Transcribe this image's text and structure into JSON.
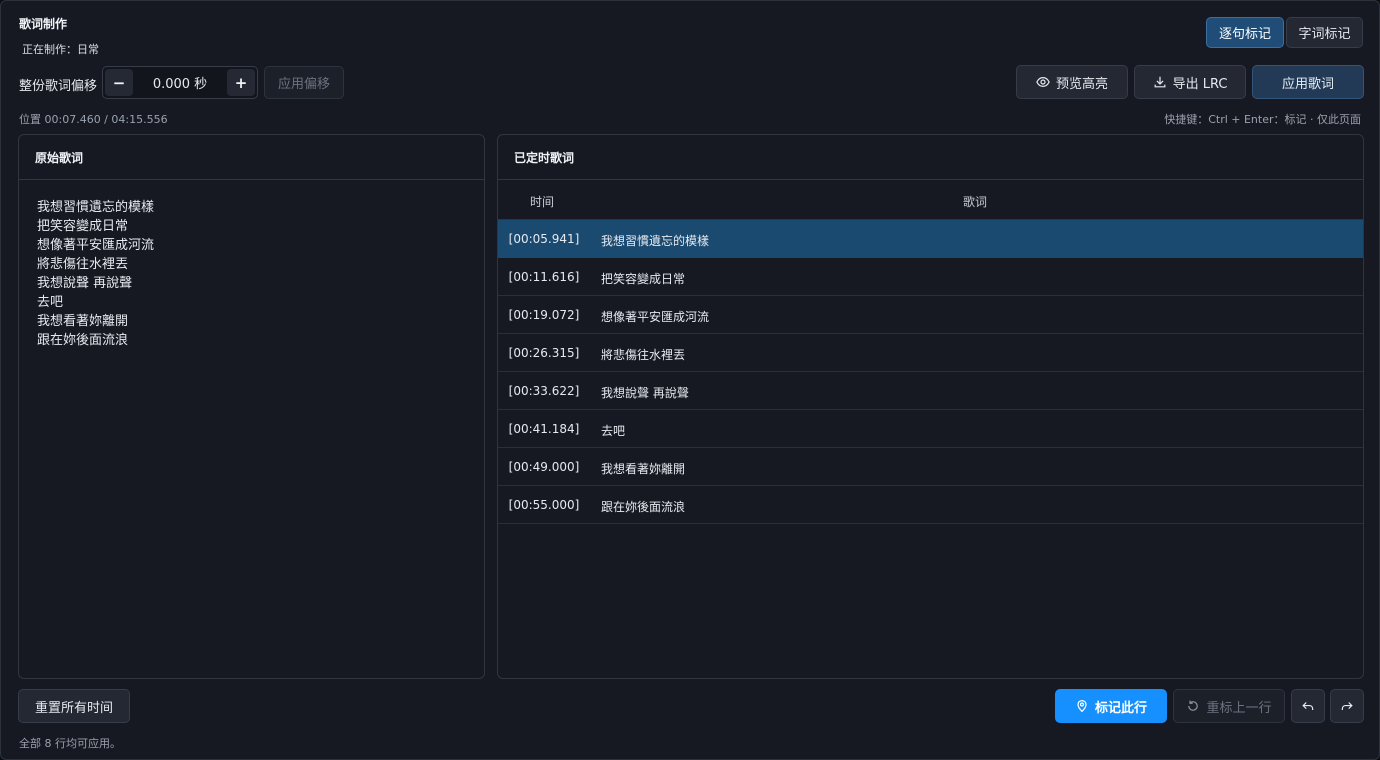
{
  "header": {
    "title": "歌词制作",
    "subtitle": "正在制作：日常",
    "mode_line": "逐句标记",
    "mode_word": "字词标记"
  },
  "offset": {
    "label": "整份歌词偏移",
    "minus": "−",
    "value": "0.000 秒",
    "plus": "+",
    "apply": "应用偏移"
  },
  "actions": {
    "preview": "预览高亮",
    "export": "导出 LRC",
    "apply_lyrics": "应用歌词"
  },
  "status": {
    "position": "位置 00:07.460 / 04:15.556",
    "shortcut": "快捷键：Ctrl + Enter：标记 · 仅此页面"
  },
  "raw_panel": {
    "title": "原始歌词",
    "lines": [
      "我想習慣遺忘的模樣",
      "把笑容變成日常",
      "想像著平安匯成河流",
      "將悲傷往水裡丟",
      "我想說聲 再說聲",
      "去吧",
      "我想看著妳離開",
      "跟在妳後面流浪"
    ]
  },
  "timed_panel": {
    "title": "已定时歌词",
    "col_time": "时间",
    "col_lyric": "歌词",
    "rows": [
      {
        "time": "[00:05.941]",
        "lyric": "我想習慣遺忘的模樣"
      },
      {
        "time": "[00:11.616]",
        "lyric": "把笑容變成日常"
      },
      {
        "time": "[00:19.072]",
        "lyric": "想像著平安匯成河流"
      },
      {
        "time": "[00:26.315]",
        "lyric": "將悲傷往水裡丟"
      },
      {
        "time": "[00:33.622]",
        "lyric": "我想說聲 再說聲"
      },
      {
        "time": "[00:41.184]",
        "lyric": "去吧"
      },
      {
        "time": "[00:49.000]",
        "lyric": "我想看著妳離開"
      },
      {
        "time": "[00:55.000]",
        "lyric": "跟在妳後面流浪"
      }
    ]
  },
  "footer": {
    "reset_all": "重置所有时间",
    "mark_line": "标记此行",
    "reset_prev": "重标上一行",
    "note": "全部 8 行均可应用。"
  },
  "colors": {
    "accent": "#1790ff",
    "active_row": "#1a4a70",
    "panel_bg": "#161922"
  }
}
